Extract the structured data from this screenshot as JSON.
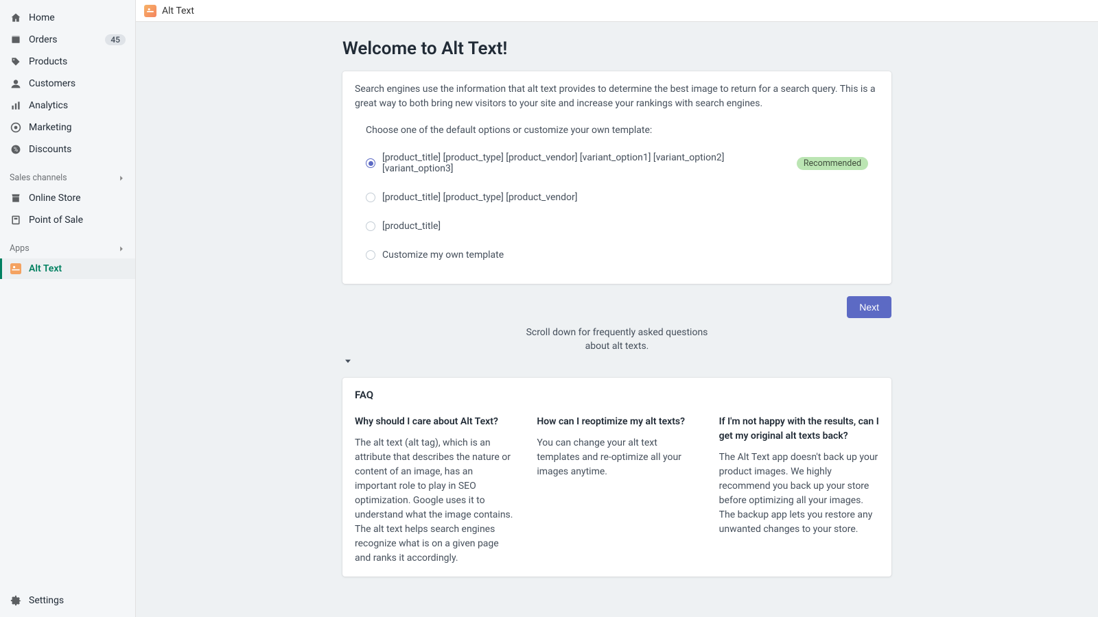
{
  "sidebar": {
    "items": [
      {
        "label": "Home",
        "icon": "home"
      },
      {
        "label": "Orders",
        "icon": "orders",
        "badge": "45"
      },
      {
        "label": "Products",
        "icon": "products"
      },
      {
        "label": "Customers",
        "icon": "customers"
      },
      {
        "label": "Analytics",
        "icon": "analytics"
      },
      {
        "label": "Marketing",
        "icon": "marketing"
      },
      {
        "label": "Discounts",
        "icon": "discounts"
      }
    ],
    "sales_channels_label": "Sales channels",
    "channels": [
      {
        "label": "Online Store",
        "icon": "online-store"
      },
      {
        "label": "Point of Sale",
        "icon": "pos"
      }
    ],
    "apps_label": "Apps",
    "apps": [
      {
        "label": "Alt Text",
        "icon": "alt-text",
        "active": true
      }
    ],
    "settings_label": "Settings"
  },
  "topbar": {
    "app_name": "Alt Text"
  },
  "main": {
    "title": "Welcome to Alt Text!",
    "description": "Search engines use the information that alt text provides to determine the best image to return for a search query. This is a great way to both bring new visitors to your site and increase your rankings with search engines.",
    "choose_label": "Choose one of the default options or customize your own template:",
    "options": [
      {
        "label": "[product_title] [product_type] [product_vendor] [variant_option1] [variant_option2] [variant_option3]",
        "recommended": true,
        "checked": true
      },
      {
        "label": "[product_title] [product_type] [product_vendor]"
      },
      {
        "label": "[product_title]"
      },
      {
        "label": "Customize my own template"
      }
    ],
    "recommended_label": "Recommended",
    "next_label": "Next",
    "scroll_hint": "Scroll down for frequently asked questions about alt texts."
  },
  "faq": {
    "title": "FAQ",
    "cols": [
      {
        "q": "Why should I care about Alt Text?",
        "a": "The alt text (alt tag), which is an attribute that describes the nature or content of an image, has an important role to play in SEO optimization. Google uses it to understand what the image contains. The alt text helps search engines recognize what is on a given page and ranks it accordingly."
      },
      {
        "q": "How can I reoptimize my alt texts?",
        "a": "You can change your alt text templates and re-optimize all your images anytime."
      },
      {
        "q": "If I'm not happy with the results, can I get my original alt texts back?",
        "a": "The Alt Text app doesn't back up your product images. We highly recommend you back up your store before optimizing all your images. The backup app lets you restore any unwanted changes to your store."
      }
    ]
  }
}
